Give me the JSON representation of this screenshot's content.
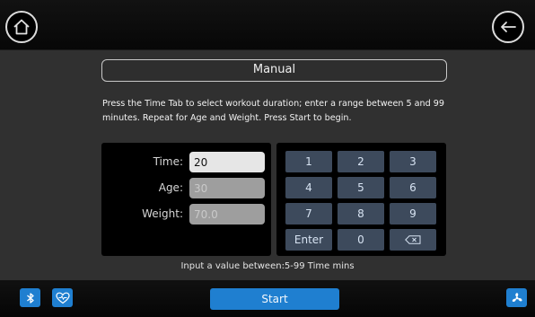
{
  "header": {
    "home_icon": "home-icon",
    "back_icon": "back-arrow-icon"
  },
  "mode": {
    "title": "Manual"
  },
  "instructions": "Press the Time Tab to select workout duration; enter a range between 5 and 99 minutes. Repeat for Age and Weight. Press Start to begin.",
  "form": {
    "time_label": "Time:",
    "time_value": "20",
    "age_label": "Age:",
    "age_value": "30",
    "weight_label": "Weight:",
    "weight_value": "70.0"
  },
  "keypad": {
    "keys": [
      "1",
      "2",
      "3",
      "4",
      "5",
      "6",
      "7",
      "8",
      "9",
      "Enter",
      "0"
    ],
    "backspace_icon": "backspace-icon"
  },
  "hint": "Input a value between:5-99 Time mins",
  "footer": {
    "start_label": "Start",
    "bluetooth_icon": "bluetooth-icon",
    "heart_rate_icon": "heart-rate-icon",
    "fan_icon": "fan-icon"
  },
  "colors": {
    "accent": "#1f7fd0",
    "key_background": "#3d4a5c",
    "panel_background": "#303030"
  }
}
